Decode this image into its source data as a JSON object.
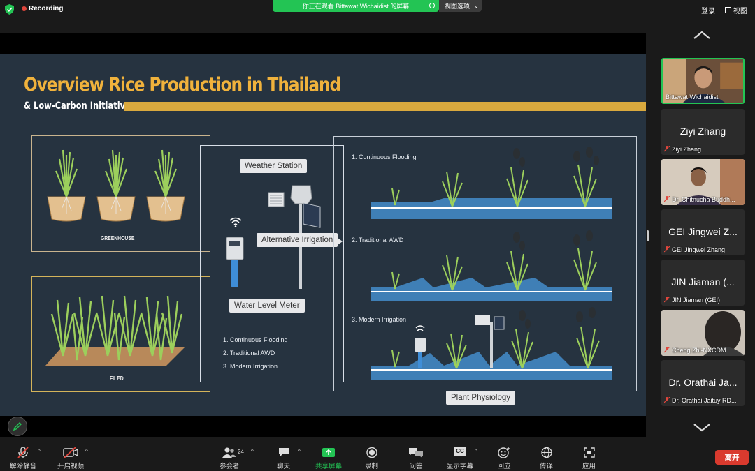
{
  "top_bar": {
    "recording_label": "Recording",
    "share_banner": "你正在观看 Bittawat Wichaidist 的屏幕",
    "view_options": "视图选项",
    "login": "登录",
    "view": "视图"
  },
  "slide": {
    "title": "Overview Rice Production in Thailand",
    "subtitle": "& Low-Carbon Initiatives",
    "greenhouse_caption": "GREENHOUSE",
    "field_caption": "FILED",
    "weather_station": "Weather Station",
    "alternative_irrigation": "Alternative Irrigation",
    "water_level_meter": "Water Level Meter",
    "plant_physiology": "Plant Physiology",
    "middle_list": [
      "1. Continuous Flooding",
      "2. Traditional AWD",
      "3. Modern Irrigation"
    ],
    "right_labels": [
      "1. Continuous Flooding",
      "2. Traditional AWD",
      "3. Modern Irrigation"
    ]
  },
  "participants": [
    {
      "display": "",
      "name": "Bittawat Wichaidist",
      "video": true,
      "active": true
    },
    {
      "display": "Ziyi Zhang",
      "name": "Ziyi Zhang",
      "video": false
    },
    {
      "display": "",
      "name": "Dr. Chitnucha Buddh...",
      "video": true
    },
    {
      "display": "GEI Jingwei Z...",
      "name": "GEI Jingwei Zhang",
      "video": false
    },
    {
      "display": "JIN Jiaman (...",
      "name": "JIN Jiaman (GEI)",
      "video": false
    },
    {
      "display": "",
      "name": "Cheng Zhi-NXCDM",
      "video": true
    },
    {
      "display": "Dr. Orathai Ja...",
      "name": "Dr. Orathai Jaituy RD...",
      "video": false
    }
  ],
  "toolbar": {
    "unmute": "解除静音",
    "start_video": "开启视频",
    "participants": "参会者",
    "participants_count": "24",
    "chat": "聊天",
    "share_screen": "共享屏幕",
    "record": "录制",
    "qa": "问答",
    "captions": "显示字幕",
    "captions_badge": "CC",
    "reactions": "回应",
    "interpretation": "传译",
    "apps": "应用",
    "leave": "离开"
  },
  "colors": {
    "accent_green": "#23c454",
    "leave_red": "#d93a2e",
    "slide_bg": "#263340",
    "title_gold": "#f0b23c"
  }
}
